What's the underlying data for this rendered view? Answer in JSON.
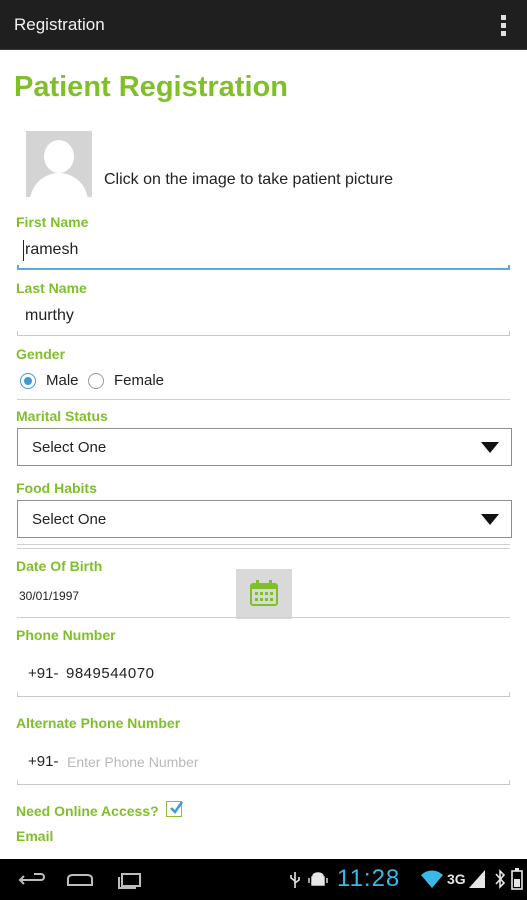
{
  "actionbar": {
    "title": "Registration",
    "overflow_icon": "overflow-menu-icon"
  },
  "page": {
    "title": "Patient Registration"
  },
  "photo": {
    "icon": "person-placeholder-icon",
    "hint": "Click on the image to take patient picture"
  },
  "first_name": {
    "label": "First Name",
    "value": "ramesh"
  },
  "last_name": {
    "label": "Last Name",
    "value": "murthy"
  },
  "gender": {
    "label": "Gender",
    "options": [
      "Male",
      "Female"
    ],
    "selected": "Male"
  },
  "marital_status": {
    "label": "Marital Status",
    "value": "Select One"
  },
  "food_habits": {
    "label": "Food Habits",
    "value": "Select One"
  },
  "dob": {
    "label": "Date Of Birth",
    "value": "30/01/1997",
    "icon": "calendar-icon"
  },
  "phone": {
    "label": "Phone Number",
    "prefix": "+91-",
    "value": "9849544070"
  },
  "alt_phone": {
    "label": "Alternate Phone Number",
    "prefix": "+91-",
    "placeholder": "Enter Phone Number"
  },
  "online_access": {
    "label": "Need Online Access?",
    "checked": true
  },
  "email": {
    "label": "Email"
  },
  "status_bar": {
    "time": "11:28",
    "network": "3G"
  },
  "colors": {
    "accent_green": "#7fbf2a",
    "focus_blue": "#5aa9d8",
    "clock_blue": "#39b9e6"
  }
}
